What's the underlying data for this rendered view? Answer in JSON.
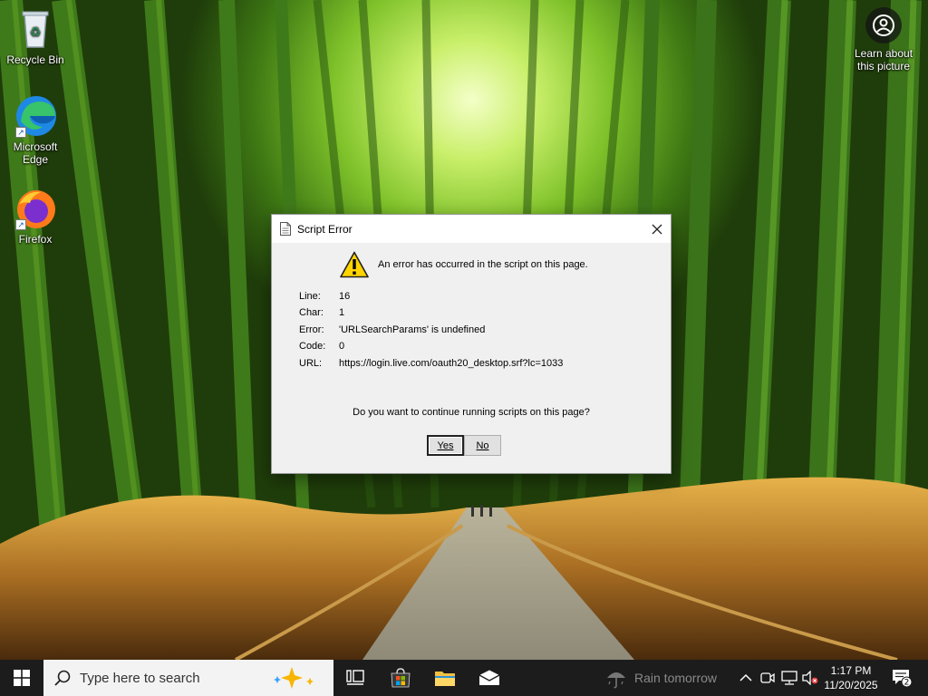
{
  "desktop": {
    "icons": [
      {
        "label": "Recycle Bin"
      },
      {
        "label": "Microsoft Edge"
      },
      {
        "label": "Firefox"
      }
    ],
    "learn_label": "Learn about this picture"
  },
  "dialog": {
    "title": "Script Error",
    "message": "An error has occurred in the script on this page.",
    "details": [
      {
        "label": "Line:",
        "value": "16"
      },
      {
        "label": "Char:",
        "value": "1"
      },
      {
        "label": "Error:",
        "value": "'URLSearchParams' is undefined"
      },
      {
        "label": "Code:",
        "value": "0"
      },
      {
        "label": "URL:",
        "value": "https://login.live.com/oauth20_desktop.srf?lc=1033"
      }
    ],
    "question": "Do you want to continue running scripts on this page?",
    "yes_label": "Yes",
    "no_label": "No"
  },
  "taskbar": {
    "search_placeholder": "Type here to search",
    "weather": "Rain tomorrow",
    "time": "1:17 PM",
    "date": "11/20/2025",
    "notification_count": "2"
  },
  "colors": {
    "taskbar": "#1c1c1c",
    "accent": "#0078d7",
    "dialog_bg": "#f0f0f0"
  }
}
